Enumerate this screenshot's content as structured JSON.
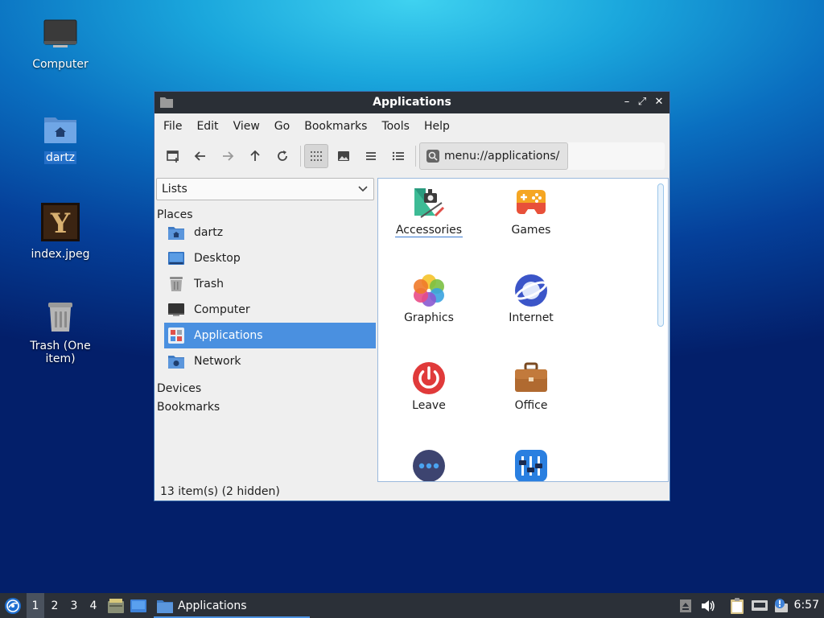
{
  "desktop": {
    "icons": [
      {
        "label": "Computer"
      },
      {
        "label": "dartz"
      },
      {
        "label": "index.jpeg"
      },
      {
        "label": "Trash (One item)"
      }
    ]
  },
  "window": {
    "title": "Applications",
    "controls": {
      "minimize": "–",
      "maximize": "⤢",
      "close": "✕"
    },
    "menu": [
      "File",
      "Edit",
      "View",
      "Go",
      "Bookmarks",
      "Tools",
      "Help"
    ],
    "toolbar": {
      "buttons": [
        "new-tab",
        "back",
        "forward",
        "up",
        "reload",
        "icon-view",
        "thumbnail-view",
        "compact-view",
        "detailed-list-view"
      ],
      "path": "menu://applications/"
    },
    "side": {
      "combo_value": "Lists",
      "places_heading": "Places",
      "places": [
        {
          "label": "dartz",
          "icon": "home-folder-icon"
        },
        {
          "label": "Desktop",
          "icon": "desktop-icon"
        },
        {
          "label": "Trash",
          "icon": "trash-icon"
        },
        {
          "label": "Computer",
          "icon": "computer-icon"
        },
        {
          "label": "Applications",
          "icon": "applications-icon",
          "selected": true
        },
        {
          "label": "Network",
          "icon": "network-icon"
        }
      ],
      "devices_heading": "Devices",
      "bookmarks_heading": "Bookmarks"
    },
    "apps": [
      {
        "label": "Accessories",
        "icon": "accessories-icon"
      },
      {
        "label": "Games",
        "icon": "games-icon"
      },
      {
        "label": "Graphics",
        "icon": "graphics-icon"
      },
      {
        "label": "Internet",
        "icon": "internet-icon"
      },
      {
        "label": "Leave",
        "icon": "leave-icon"
      },
      {
        "label": "Office",
        "icon": "office-icon"
      },
      {
        "label": "",
        "icon": "other-icon"
      },
      {
        "label": "",
        "icon": "sound-video-icon"
      }
    ],
    "status": "13 item(s) (2 hidden)"
  },
  "taskbar": {
    "workspaces": [
      "1",
      "2",
      "3",
      "4"
    ],
    "active_workspace": "1",
    "task_label": "Applications",
    "clock": "6:57"
  },
  "colors": {
    "accent": "#4a90e0",
    "titlebar": "#2a2f36",
    "taskbar": "#2b3038"
  }
}
